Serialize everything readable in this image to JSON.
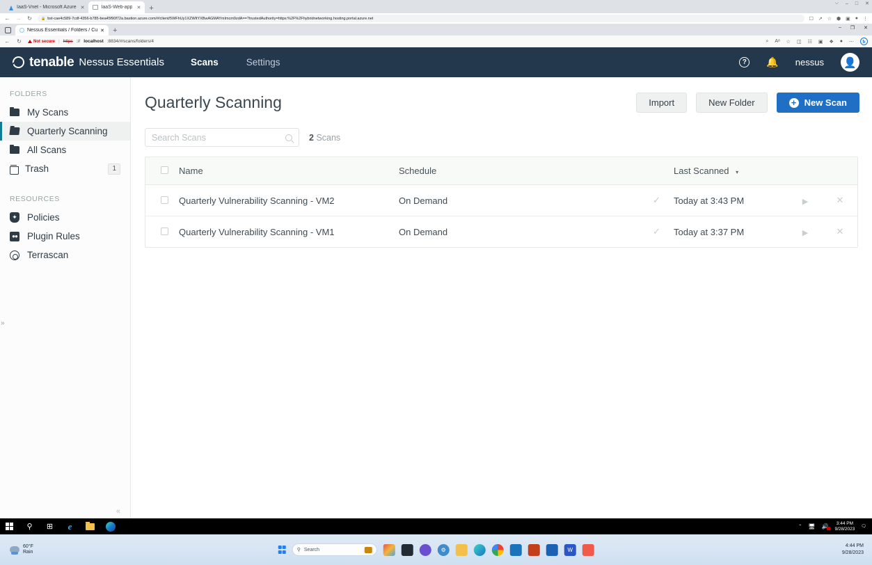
{
  "outer_browser": {
    "tabs": [
      {
        "title": "IaaS-Vnet - Microsoft Azure",
        "favicon": "azure-icon",
        "active": false
      },
      {
        "title": "IaaS-Web-app",
        "favicon": "page-icon",
        "active": true
      }
    ],
    "new_tab_label": "+",
    "url": "bst-cae4c589-7cdf-4356-b785-bea45f90f72a.bastion.azure.com/#/client/5WFhUy1XZWltYXBwAGMAYmImcm9zdA==?trustedAuthority=https:%2F%2Fhybridnetworking.hosting.portal.azure.net",
    "window_controls": {
      "minimize": "–",
      "maximize": "□",
      "close": "✕",
      "collapse": "⌵"
    },
    "toolbar_icons": [
      "back-arrow",
      "forward-arrow",
      "reload-icon",
      "lock-icon",
      "bookmark-panel-icon",
      "share-icon",
      "star-icon",
      "extensions-icon",
      "sidepanel-icon",
      "profile-icon",
      "menu-icon"
    ]
  },
  "inner_browser": {
    "tab": {
      "title": "Nessus Essentials / Folders / Cu",
      "close_label": "✕"
    },
    "new_tab_label": "+",
    "security_label": "Not secure",
    "url_scheme": "https",
    "url_host": "localhost",
    "url_path": ":8834/#/scans/folders/4",
    "window_controls": {
      "minimize": "–",
      "restore": "❐",
      "close": "✕"
    },
    "toolbar_icons": [
      "back-arrow",
      "reload-icon",
      "zoom-icon",
      "read-aloud-icon",
      "favorite-star-icon",
      "split-screen-icon",
      "collections-icon",
      "browser-essentials-icon",
      "profile-icon",
      "settings-more-icon",
      "bing-copilot-icon"
    ],
    "bing_label": "b"
  },
  "app": {
    "header": {
      "brand_name": "tenable",
      "product_name": "Nessus Essentials",
      "nav": [
        {
          "label": "Scans",
          "active": true
        },
        {
          "label": "Settings",
          "active": false
        }
      ],
      "help_label": "?",
      "bell_icon": "notification-bell-icon",
      "username": "nessus",
      "avatar_glyph": "●"
    },
    "sidebar": {
      "sections": [
        {
          "title": "FOLDERS",
          "items": [
            {
              "label": "My Scans",
              "icon": "folder-icon",
              "active": false,
              "badge": ""
            },
            {
              "label": "Quarterly Scanning",
              "icon": "folder-open-icon",
              "active": true,
              "badge": ""
            },
            {
              "label": "All Scans",
              "icon": "folder-icon",
              "active": false,
              "badge": ""
            },
            {
              "label": "Trash",
              "icon": "trash-icon",
              "active": false,
              "badge": "1"
            }
          ]
        },
        {
          "title": "RESOURCES",
          "items": [
            {
              "label": "Policies",
              "icon": "shield-icon",
              "active": false,
              "badge": ""
            },
            {
              "label": "Plugin Rules",
              "icon": "plugin-icon",
              "active": false,
              "badge": ""
            },
            {
              "label": "Terrascan",
              "icon": "terrascan-icon",
              "active": false,
              "badge": ""
            }
          ]
        }
      ],
      "collapse_label": "«",
      "expand_label": "»"
    },
    "page": {
      "title": "Quarterly Scanning",
      "buttons": {
        "import": "Import",
        "new_folder": "New Folder",
        "new_scan": "New Scan",
        "new_scan_icon": "plus-circle-icon"
      },
      "search_placeholder": "Search Scans",
      "search_value": "",
      "scan_count_number": "2",
      "scan_count_label": "Scans"
    },
    "table": {
      "columns": [
        "Name",
        "Schedule",
        "Last Scanned"
      ],
      "sort_column": "Last Scanned",
      "sort_caret": "▾",
      "rows": [
        {
          "name": "Quarterly Vulnerability Scanning - VM2",
          "schedule": "On Demand",
          "status_icon": "check-icon",
          "last_scanned": "Today at 3:43 PM",
          "launch_icon": "play-icon",
          "delete_icon": "close-icon"
        },
        {
          "name": "Quarterly Vulnerability Scanning - VM1",
          "schedule": "On Demand",
          "status_icon": "check-icon",
          "last_scanned": "Today at 3:37 PM",
          "launch_icon": "play-icon",
          "delete_icon": "close-icon"
        }
      ]
    }
  },
  "inner_taskbar": {
    "icons": [
      "windows-start-icon",
      "search-icon",
      "task-view-icon",
      "internet-explorer-icon",
      "file-explorer-icon",
      "edge-icon"
    ],
    "tray": {
      "chevron": "⌃",
      "network_icon": "network-icon",
      "volume_icon": "volume-muted-icon",
      "time": "3:44 PM",
      "date": "9/28/2023",
      "action_center_icon": "action-center-icon"
    }
  },
  "outer_taskbar": {
    "weather_temp": "60°F",
    "weather_cond": "Rain",
    "search_placeholder": "Search",
    "apps": [
      "windows-start-icon",
      "photos-icon",
      "terminal-icon",
      "teams-icon",
      "settings-icon",
      "file-explorer-icon",
      "edge-icon",
      "chrome-icon",
      "outlook-icon",
      "office-icon",
      "store-icon",
      "word-icon",
      "paint-icon"
    ],
    "clock_time": "4:44 PM",
    "clock_date": "9/28/2023"
  }
}
